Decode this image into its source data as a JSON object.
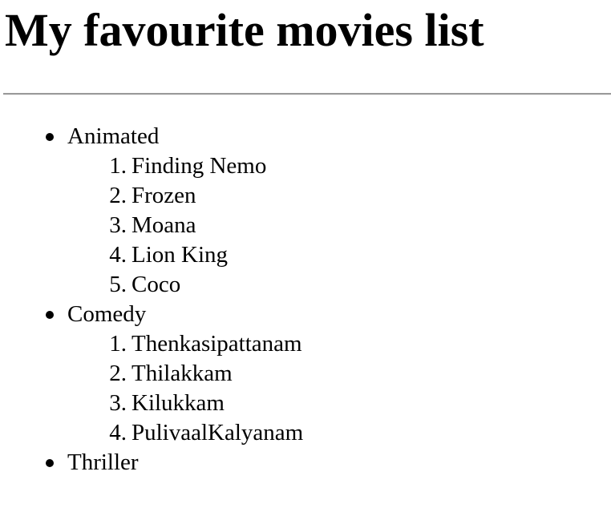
{
  "page": {
    "title": "My favourite movies list"
  },
  "categories": [
    {
      "label": "Animated",
      "movies": [
        {
          "number": "1.",
          "title": "Finding Nemo"
        },
        {
          "number": "2.",
          "title": "Frozen"
        },
        {
          "number": "3.",
          "title": "Moana"
        },
        {
          "number": "4.",
          "title": "Lion King"
        },
        {
          "number": "5.",
          "title": "Coco"
        }
      ]
    },
    {
      "label": "Comedy",
      "movies": [
        {
          "number": "1.",
          "title": "Thenkasipattanam"
        },
        {
          "number": "2.",
          "title": "Thilakkam"
        },
        {
          "number": "3.",
          "title": "Kilukkam"
        },
        {
          "number": "4.",
          "title": "PulivaalKalyanam"
        }
      ]
    },
    {
      "label": "Thriller",
      "movies": []
    }
  ]
}
